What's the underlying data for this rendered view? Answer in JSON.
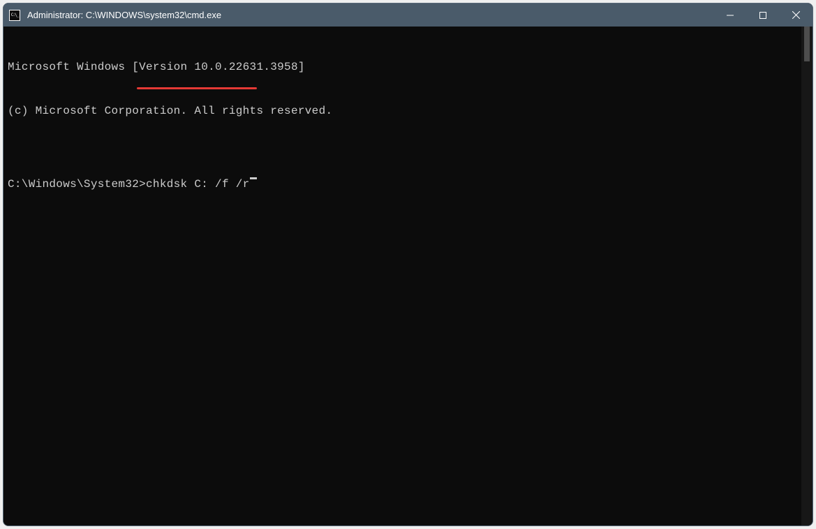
{
  "titlebar": {
    "title": "Administrator: C:\\WINDOWS\\system32\\cmd.exe",
    "icon_name": "cmd-icon"
  },
  "terminal": {
    "line1": "Microsoft Windows [Version 10.0.22631.3958]",
    "line2": "(c) Microsoft Corporation. All rights reserved.",
    "blank": "",
    "prompt": "C:\\Windows\\System32>",
    "command": "chkdsk C: /f /r"
  },
  "annotation": {
    "underline_color": "#e53935"
  }
}
